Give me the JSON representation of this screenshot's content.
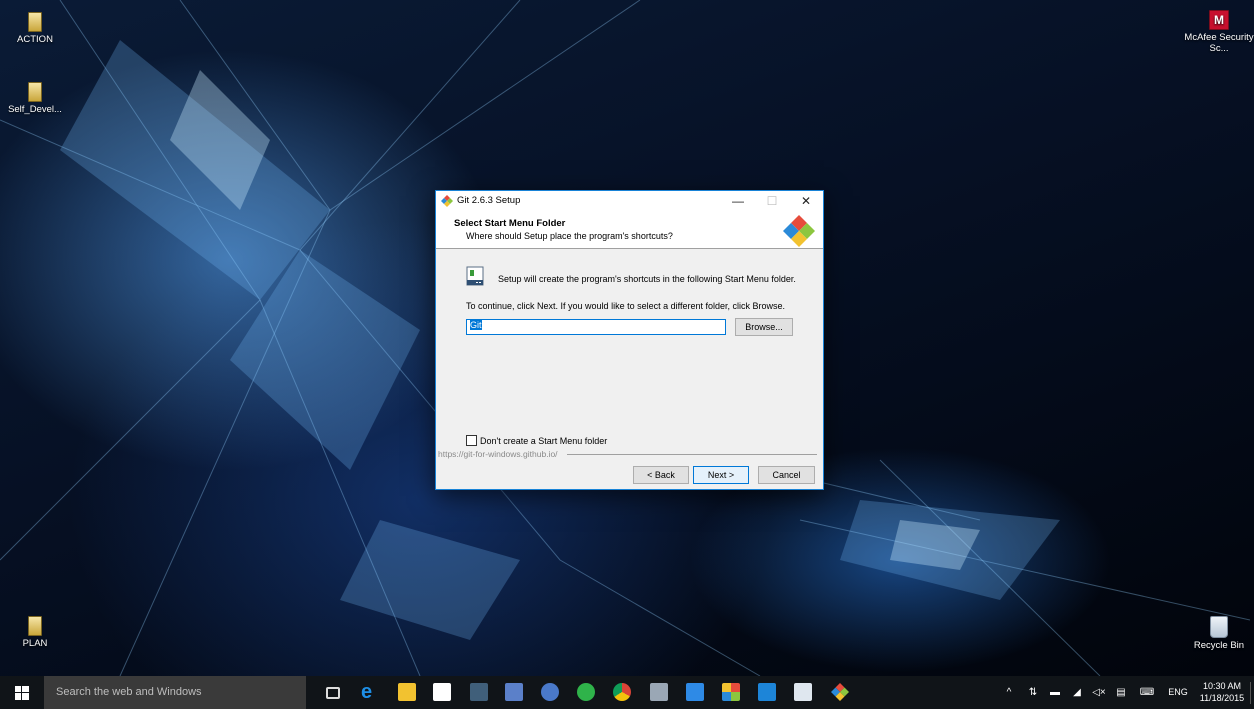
{
  "desktop": {
    "icons": [
      {
        "label": "ACTION"
      },
      {
        "label": "Self_Devel..."
      },
      {
        "label": "PLAN"
      },
      {
        "label": "McAfee Security Sc..."
      },
      {
        "label": "Recycle Bin"
      }
    ]
  },
  "dialog": {
    "title": "Git 2.6.3 Setup",
    "header_title": "Select Start Menu Folder",
    "header_subtitle": "Where should Setup place the program's shortcuts?",
    "info_text": "Setup will create the program's shortcuts in the following Start Menu folder.",
    "continue_text": "To continue, click Next. If you would like to select a different folder, click Browse.",
    "folder_value": "Git",
    "browse_label": "Browse...",
    "checkbox_label": "Don't create a Start Menu folder",
    "checkbox_checked": false,
    "footer_link": "https://git-for-windows.github.io/",
    "back_label": "< Back",
    "next_label": "Next >",
    "cancel_label": "Cancel",
    "minimize_glyph": "—",
    "maximize_glyph": "☐",
    "close_glyph": "✕"
  },
  "taskbar": {
    "search_placeholder": "Search the web and Windows",
    "pinned_apps": [
      "task-view-icon",
      "edge-icon",
      "file-explorer-icon",
      "store-icon",
      "media-app-icon",
      "save-app-icon",
      "settings-app-icon",
      "whatsapp-icon",
      "chrome-icon",
      "image-app-icon",
      "dropbox-icon",
      "office-app-icon",
      "teamviewer-icon",
      "notepad-icon",
      "git-setup-icon"
    ],
    "tray": {
      "chevron": "^",
      "language": "ENG",
      "time": "10:30 AM",
      "date": "11/18/2015"
    }
  },
  "colors": {
    "accent": "#0078d7",
    "git_red": "#e64c3c",
    "git_blue": "#2b8ad8",
    "git_green": "#8cc63f",
    "git_yellow": "#f2c230"
  }
}
